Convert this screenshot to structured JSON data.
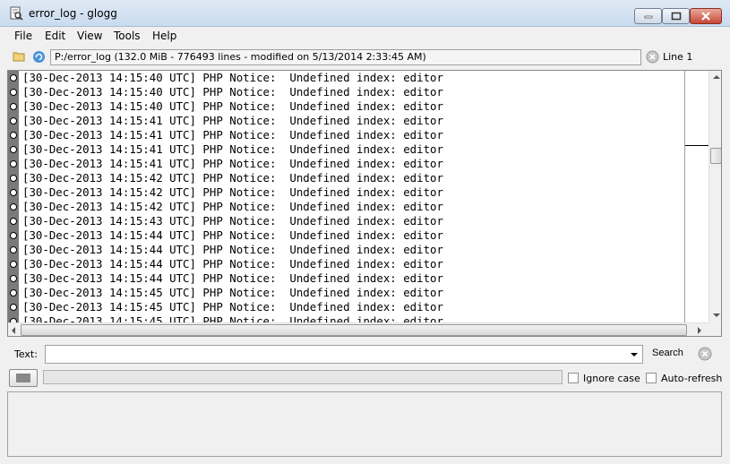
{
  "window": {
    "title": "error_log - glogg"
  },
  "menu": [
    "File",
    "Edit",
    "View",
    "Tools",
    "Help"
  ],
  "infobar": {
    "file_info": "P:/error_log (132.0 MiB - 776493 lines - modified on 5/13/2014 2:33:45 AM)",
    "line_indicator": "Line 1"
  },
  "log": {
    "lines": [
      "[30-Dec-2013 14:15:40 UTC] PHP Notice:  Undefined index: editor",
      "[30-Dec-2013 14:15:40 UTC] PHP Notice:  Undefined index: editor",
      "[30-Dec-2013 14:15:40 UTC] PHP Notice:  Undefined index: editor",
      "[30-Dec-2013 14:15:41 UTC] PHP Notice:  Undefined index: editor",
      "[30-Dec-2013 14:15:41 UTC] PHP Notice:  Undefined index: editor",
      "[30-Dec-2013 14:15:41 UTC] PHP Notice:  Undefined index: editor",
      "[30-Dec-2013 14:15:41 UTC] PHP Notice:  Undefined index: editor",
      "[30-Dec-2013 14:15:42 UTC] PHP Notice:  Undefined index: editor",
      "[30-Dec-2013 14:15:42 UTC] PHP Notice:  Undefined index: editor",
      "[30-Dec-2013 14:15:42 UTC] PHP Notice:  Undefined index: editor",
      "[30-Dec-2013 14:15:43 UTC] PHP Notice:  Undefined index: editor",
      "[30-Dec-2013 14:15:44 UTC] PHP Notice:  Undefined index: editor",
      "[30-Dec-2013 14:15:44 UTC] PHP Notice:  Undefined index: editor",
      "[30-Dec-2013 14:15:44 UTC] PHP Notice:  Undefined index: editor",
      "[30-Dec-2013 14:15:44 UTC] PHP Notice:  Undefined index: editor",
      "[30-Dec-2013 14:15:45 UTC] PHP Notice:  Undefined index: editor",
      "[30-Dec-2013 14:15:45 UTC] PHP Notice:  Undefined index: editor",
      "[30-Dec-2013 14:15:45 UTC] PHP Notice:  Undefined index: editor"
    ]
  },
  "search": {
    "label": "Text:",
    "value": "",
    "button": "Search",
    "ignore_case": "Ignore case",
    "auto_refresh": "Auto-refresh",
    "ignore_case_checked": false,
    "auto_refresh_checked": false
  },
  "icons": {
    "app": "glogg-icon",
    "open": "open-folder-icon",
    "reload": "reload-icon",
    "close": "close-circle-icon"
  },
  "colors": {
    "gutter": "#7a7a7a",
    "close_button": "#c74835"
  }
}
